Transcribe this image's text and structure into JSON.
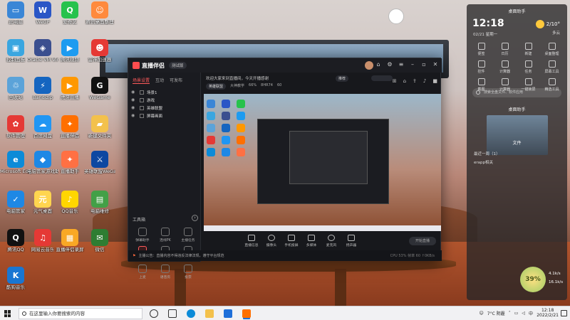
{
  "desktop_icons": [
    {
      "label": "此电脑",
      "color": "#3a86d6",
      "glyph": "▭"
    },
    {
      "label": "WeGP",
      "color": "#2a56c6",
      "glyph": "W"
    },
    {
      "label": "爱奇艺",
      "color": "#27c24c",
      "glyph": "Q"
    },
    {
      "label": "腾讯桌面整理",
      "color": "#ff8a3d",
      "glyph": "☺"
    },
    {
      "label": "控制面板",
      "color": "#3aa6e0",
      "glyph": "▣"
    },
    {
      "label": "Oracle VM VirtualBox",
      "color": "#3b4f8f",
      "glyph": "◈"
    },
    {
      "label": "腾讯视频",
      "color": "#1d9bf0",
      "glyph": "▶"
    },
    {
      "label": "雷神加速器",
      "color": "#e53935",
      "glyph": "☻"
    },
    {
      "label": "回收站",
      "color": "#5ba3d9",
      "glyph": "♲"
    },
    {
      "label": "Bandizip",
      "color": "#1565c0",
      "glyph": "⚡"
    },
    {
      "label": "虎牙直播",
      "color": "#ff9800",
      "glyph": "▶"
    },
    {
      "label": "WeGame",
      "color": "#111111",
      "glyph": "G"
    },
    {
      "label": "软件管理",
      "color": "#e53935",
      "glyph": "✿"
    },
    {
      "label": "百度网盘",
      "color": "#2196f3",
      "glyph": "☁"
    },
    {
      "label": "直播伴侣",
      "color": "#ff6f00",
      "glyph": "✦"
    },
    {
      "label": "新建文件夹",
      "color": "#f3c14c",
      "glyph": "▰"
    },
    {
      "label": "Microsoft Edge",
      "color": "#0c8bd8",
      "glyph": "e"
    },
    {
      "label": "电脑管家游戏助手",
      "color": "#1e88e5",
      "glyph": "◆"
    },
    {
      "label": "直播助手",
      "color": "#ff7043",
      "glyph": "✦"
    },
    {
      "label": "英雄联盟WeGame版",
      "color": "#0d47a1",
      "glyph": "⚔"
    },
    {
      "label": "电脑管家",
      "color": "#1e88e5",
      "glyph": "✓"
    },
    {
      "label": "元气桌面",
      "color": "#ffd54f",
      "glyph": "元"
    },
    {
      "label": "QQ音乐",
      "color": "#ffd600",
      "glyph": "♪"
    },
    {
      "label": "电脑维修",
      "color": "#43a047",
      "glyph": "▤"
    },
    {
      "label": "腾讯QQ",
      "color": "#111111",
      "glyph": "Q"
    },
    {
      "label": "网易云音乐",
      "color": "#e53935",
      "glyph": "♫"
    },
    {
      "label": "直播伴侣录屏",
      "color": "#f9a825",
      "glyph": "▦"
    },
    {
      "label": "微信",
      "color": "#2e7d32",
      "glyph": "✉"
    },
    {
      "label": "酷狗音乐",
      "color": "#1976d2",
      "glyph": "K"
    }
  ],
  "app": {
    "logo": "直播伴侣",
    "version": "测试版",
    "side_tabs": [
      "场景设置",
      "互动",
      "可发布"
    ],
    "scenes": [
      "场景1",
      "游戏",
      "英雄联盟",
      "屏幕画面"
    ],
    "tools_title": "工具箱",
    "tools": [
      {
        "label": "弹幕助手",
        "hot": false
      },
      {
        "label": "连线PK",
        "hot": false
      },
      {
        "label": "主播任务",
        "hot": false
      },
      {
        "label": "录屏",
        "hot": true
      },
      {
        "label": "连麦",
        "hot": false
      },
      {
        "label": "全民PK",
        "hot": false
      },
      {
        "label": "上麦",
        "hot": false
      },
      {
        "label": "语音房",
        "hot": false
      },
      {
        "label": "投票",
        "hot": false
      }
    ],
    "notice": "欢迎大家来到直播间，今天开播感谢",
    "chip_1": "推荐",
    "chip_2": "",
    "category_label": "英雄联盟",
    "category_tags": [
      "大神教学",
      "66%",
      "8HR74",
      "60"
    ],
    "controls": [
      "直播信息",
      "摄像头",
      "手机投屏",
      "多媒体",
      "麦克风",
      "扬声器"
    ],
    "start_live": "开始直播",
    "status_text": "主播公告：直播内容不得违反法律法规，遵守平台规范",
    "status_stats": "CPU 53% 帧率 60 ↑0KB/s"
  },
  "panel": {
    "title": "桌面助手",
    "time": "12:18",
    "date": "02/21 星期一",
    "weather_temp": "2/10°",
    "weather_desc": "多云",
    "shortcuts": [
      "便签",
      "日历",
      "新建",
      "桌面整理",
      "控件",
      "计算器",
      "任务",
      "屏幕工具",
      "截图",
      "计算器",
      "一键锁屏",
      "精选工具"
    ],
    "search_placeholder": "搜索全盘文件、软件应用",
    "subpanel_title": "桌面助手",
    "files_title": "文件",
    "file_items": [
      "最近一周（1）",
      "erapp相关"
    ],
    "battery_pct": "39%",
    "net_up": "4.1k/s",
    "net_down": "16.1k/s"
  },
  "taskbar": {
    "search_placeholder": "在这里输入你要搜索的内容",
    "weather": "7°C 阴霾",
    "ime": "中",
    "time": "12:18",
    "date": "2022/2/21"
  }
}
